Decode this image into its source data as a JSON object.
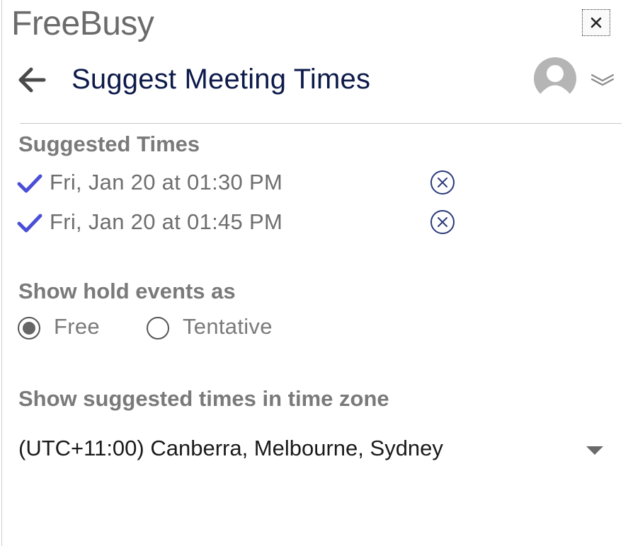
{
  "app": {
    "title": "FreeBusy"
  },
  "header": {
    "title": "Suggest Meeting Times"
  },
  "suggested": {
    "heading": "Suggested Times",
    "times": [
      {
        "label": "Fri, Jan 20 at 01:30 PM"
      },
      {
        "label": "Fri, Jan 20 at 01:45 PM"
      }
    ]
  },
  "hold": {
    "heading": "Show hold events as",
    "options": [
      {
        "label": "Free",
        "selected": true
      },
      {
        "label": "Tentative",
        "selected": false
      }
    ]
  },
  "timezone": {
    "heading": "Show suggested times in time zone",
    "value": "(UTC+11:00) Canberra, Melbourne, Sydney"
  },
  "icons": {
    "close": "close-icon",
    "back": "arrow-left-icon",
    "avatar": "user-avatar-icon",
    "menu": "double-chevron-down-icon",
    "check": "checkmark-icon",
    "remove": "circle-x-icon",
    "caret": "caret-down-icon"
  },
  "colors": {
    "title_navy": "#0d1a4a",
    "check_blue": "#4a4fd6",
    "remove_navy": "#2b3a7a",
    "heading_gray": "#7a7a7a"
  }
}
